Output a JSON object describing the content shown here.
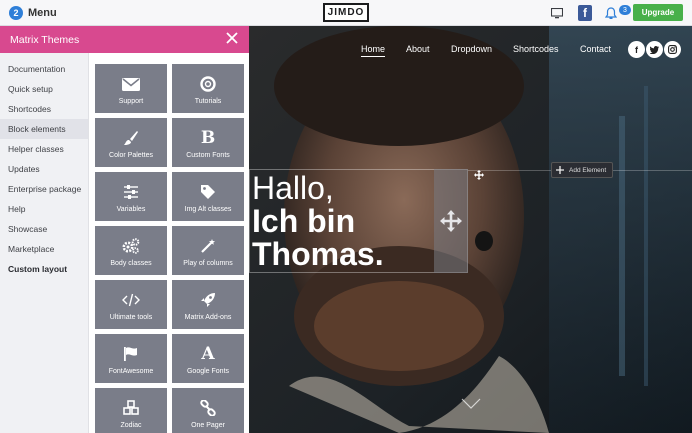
{
  "topbar": {
    "menu_count": "2",
    "menu_label": "Menu",
    "logo": "JIMDO",
    "notifications": "3",
    "upgrade_label": "Upgrade"
  },
  "panel": {
    "title": "Matrix Themes",
    "sidebar": [
      {
        "label": "Documentation"
      },
      {
        "label": "Quick setup"
      },
      {
        "label": "Shortcodes"
      },
      {
        "label": "Block elements"
      },
      {
        "label": "Helper classes"
      },
      {
        "label": "Updates"
      },
      {
        "label": "Enterprise package"
      },
      {
        "label": "Help"
      },
      {
        "label": "Showcase"
      },
      {
        "label": "Marketplace"
      },
      {
        "label": "Custom layout"
      }
    ],
    "tiles": [
      {
        "label": "Support",
        "icon": "envelope-icon"
      },
      {
        "label": "Tutorials",
        "icon": "lifebuoy-icon"
      },
      {
        "label": "Color Palettes",
        "icon": "paintbrush-icon"
      },
      {
        "label": "Custom Fonts",
        "icon": "bold-b-icon"
      },
      {
        "label": "Variables",
        "icon": "sliders-icon"
      },
      {
        "label": "Img Alt classes",
        "icon": "tag-icon"
      },
      {
        "label": "Body classes",
        "icon": "cogs-icon"
      },
      {
        "label": "Play of columns",
        "icon": "magic-wand-icon"
      },
      {
        "label": "Ultimate tools",
        "icon": "code-icon"
      },
      {
        "label": "Matrix Add-ons",
        "icon": "rocket-icon"
      },
      {
        "label": "FontAwesome",
        "icon": "flag-icon"
      },
      {
        "label": "Google Fonts",
        "icon": "font-a-icon"
      },
      {
        "label": "Zodiac",
        "icon": "cubes-icon"
      },
      {
        "label": "One Pager",
        "icon": "link-icon"
      }
    ]
  },
  "site": {
    "nav": [
      {
        "label": "Home"
      },
      {
        "label": "About"
      },
      {
        "label": "Dropdown"
      },
      {
        "label": "Shortcodes"
      },
      {
        "label": "Contact"
      }
    ],
    "headline_line1": "Hallo,",
    "headline_line2": "Ich bin",
    "headline_line3": "Thomas.",
    "add_element_label": "Add Element"
  },
  "colors": {
    "panel_header": "#d8498f",
    "tile_bg": "#7a7d89",
    "upgrade": "#48b04a",
    "accent_blue": "#2f7fd8"
  }
}
